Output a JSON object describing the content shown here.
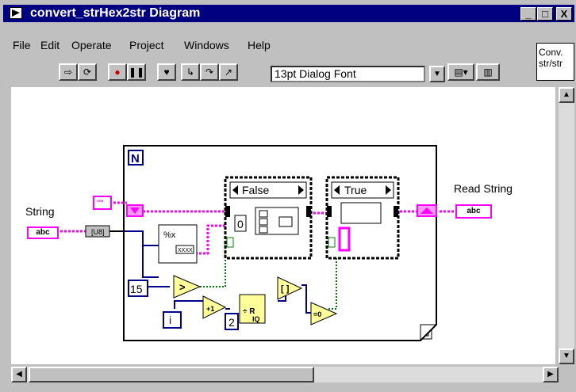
{
  "window": {
    "title": "convert_strHex2str Diagram",
    "minimize": "_",
    "maximize": "□",
    "close": "X"
  },
  "menu": {
    "items": [
      "File",
      "Edit",
      "Operate",
      "Project",
      "Windows",
      "Help"
    ]
  },
  "toolbar": {
    "font_selector": "13pt Dialog Font",
    "connector_icon_text": "Conv. str/str"
  },
  "diagram": {
    "input_label": "String",
    "output_label": "Read String",
    "case_false": "False",
    "case_true": "True",
    "for_loop_count": "N",
    "iteration": "i",
    "const_15": "15",
    "const_2": "2",
    "const_0": "0",
    "terminal_abc": "abc",
    "quote_const": "\"\"",
    "fmt_text": "%x"
  },
  "colors": {
    "string_wire": "#ff00ff",
    "numeric_wire": "#00008b",
    "bool_wire": "#008000",
    "title_bar": "#000080"
  }
}
